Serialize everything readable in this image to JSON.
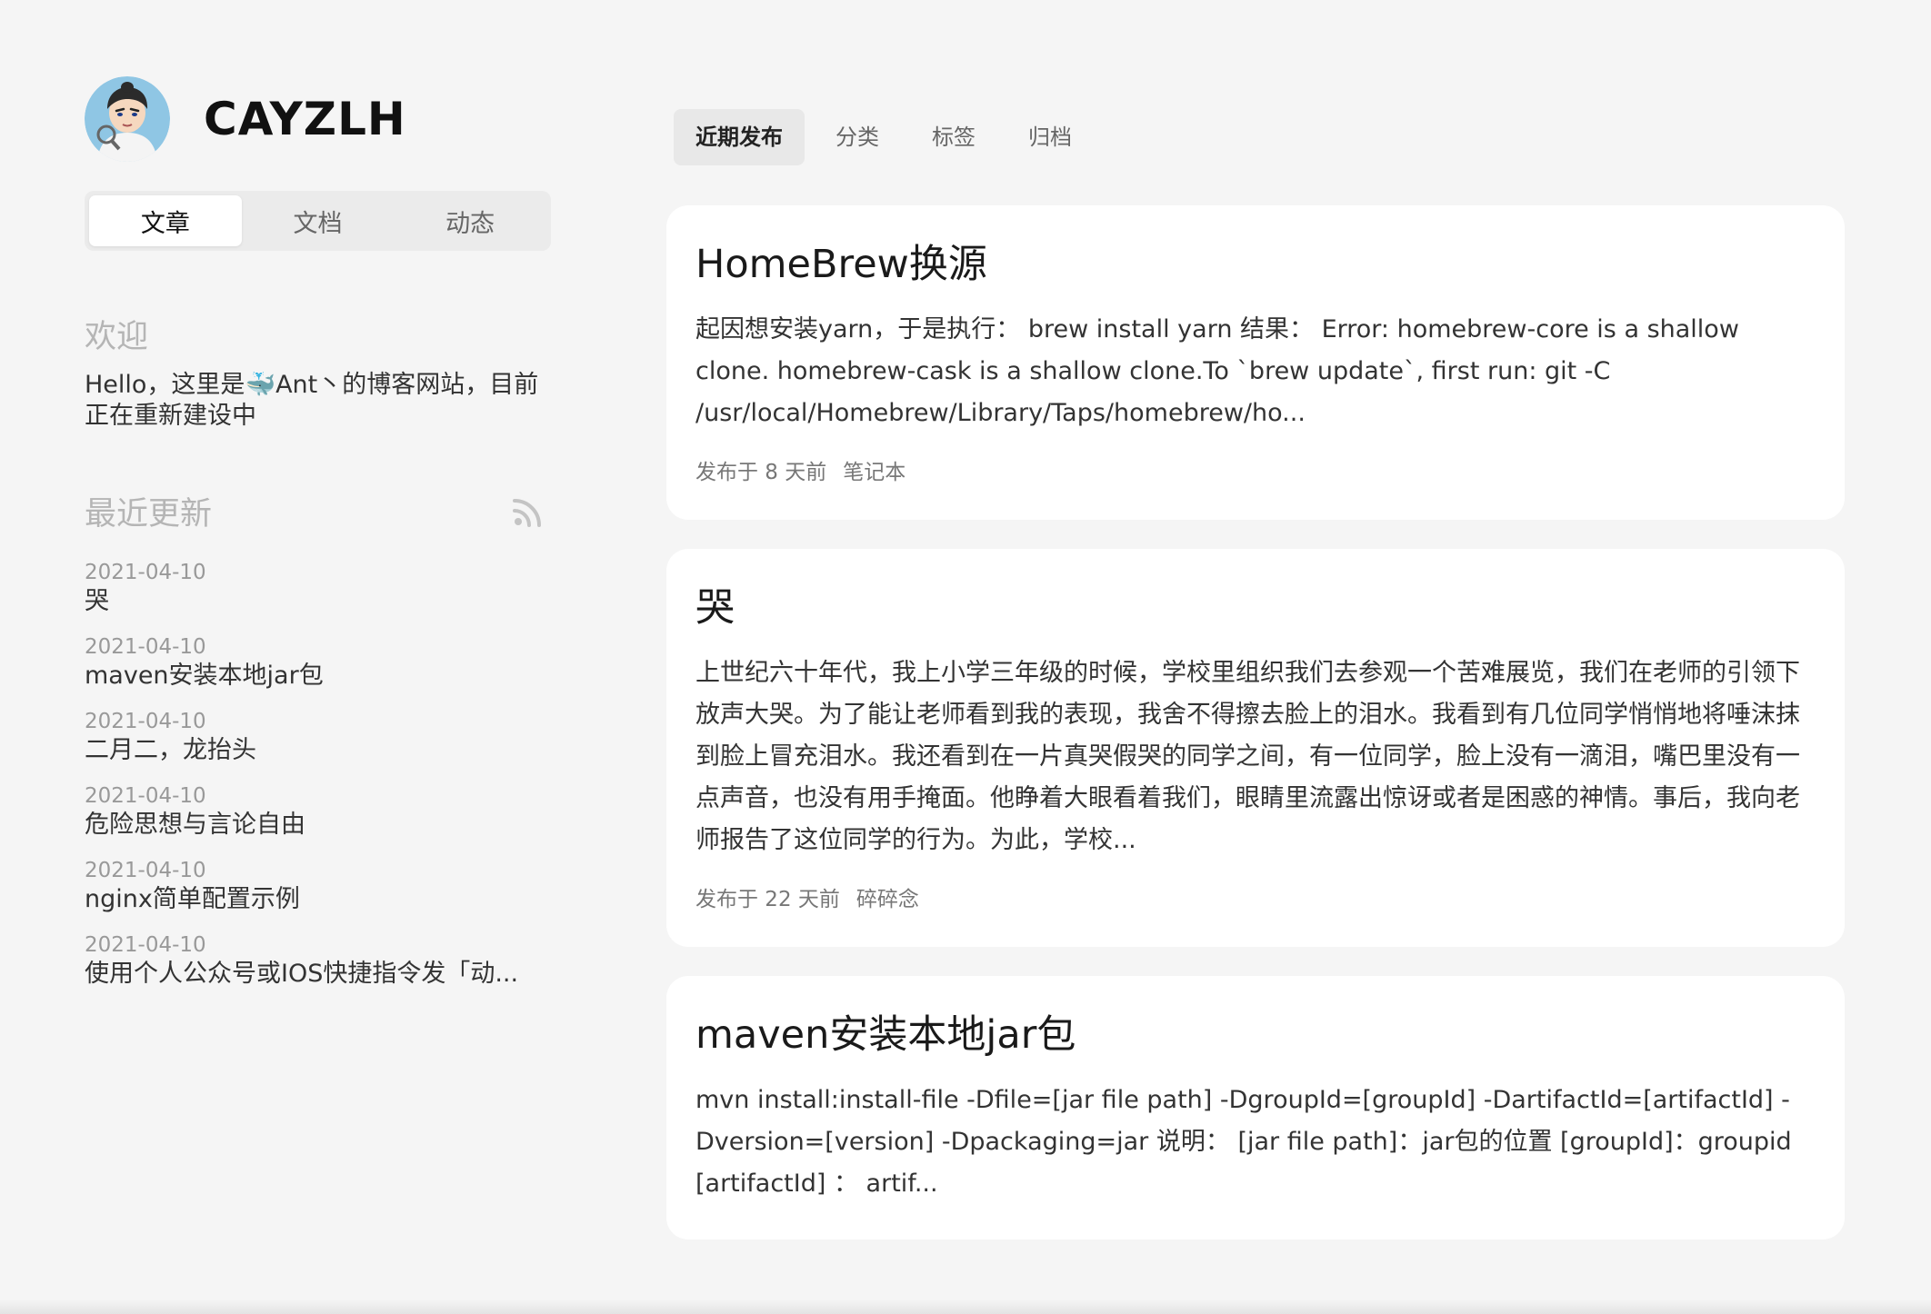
{
  "site": {
    "title": "CAYZLH"
  },
  "sidebar": {
    "segments": [
      {
        "label": "文章",
        "active": true
      },
      {
        "label": "文档",
        "active": false
      },
      {
        "label": "动态",
        "active": false
      }
    ],
    "welcome": {
      "title": "欢迎",
      "text_before": "Hello，这里是",
      "emoji": "🐳",
      "text_after": "Ant丶的博客网站，目前正在重新建设中"
    },
    "recent": {
      "title": "最近更新",
      "icon": "rss-icon",
      "items": [
        {
          "date": "2021-04-10",
          "title": "哭"
        },
        {
          "date": "2021-04-10",
          "title": "maven安装本地jar包"
        },
        {
          "date": "2021-04-10",
          "title": "二月二，龙抬头"
        },
        {
          "date": "2021-04-10",
          "title": "危险思想与言论自由"
        },
        {
          "date": "2021-04-10",
          "title": "nginx简单配置示例"
        },
        {
          "date": "2021-04-10",
          "title": "使用个人公众号或IOS快捷指令发「动..."
        }
      ]
    }
  },
  "main": {
    "tabs": [
      {
        "label": "近期发布",
        "active": true
      },
      {
        "label": "分类",
        "active": false
      },
      {
        "label": "标签",
        "active": false
      },
      {
        "label": "归档",
        "active": false
      }
    ],
    "posts": [
      {
        "title": "HomeBrew换源",
        "excerpt": "起因想安装yarn，于是执行： brew install yarn 结果： Error: homebrew-core is a shallow clone. homebrew-cask is a shallow clone.To `brew update`, first run: git -C /usr/local/Homebrew/Library/Taps/homebrew/ho...",
        "published": "发布于 8 天前",
        "category": "笔记本"
      },
      {
        "title": "哭",
        "excerpt": "上世纪六十年代，我上小学三年级的时候，学校里组织我们去参观一个苦难展览，我们在老师的引领下放声大哭。为了能让老师看到我的表现，我舍不得擦去脸上的泪水。我看到有几位同学悄悄地将唾沫抹到脸上冒充泪水。我还看到在一片真哭假哭的同学之间，有一位同学，脸上没有一滴泪，嘴巴里没有一点声音，也没有用手掩面。他睁着大眼看着我们，眼睛里流露出惊讶或者是困惑的神情。事后，我向老师报告了这位同学的行为。为此，学校...",
        "published": "发布于 22 天前",
        "category": "碎碎念"
      },
      {
        "title": "maven安装本地jar包",
        "excerpt": "mvn install:install-file -Dfile=[jar file path] -DgroupId=[groupId] -DartifactId=[artifactId] -Dversion=[version] -Dpackaging=jar 说明： [jar file path]：jar包的位置 [groupId]：groupid [artifactId] ： artif...",
        "published": "",
        "category": ""
      }
    ]
  }
}
